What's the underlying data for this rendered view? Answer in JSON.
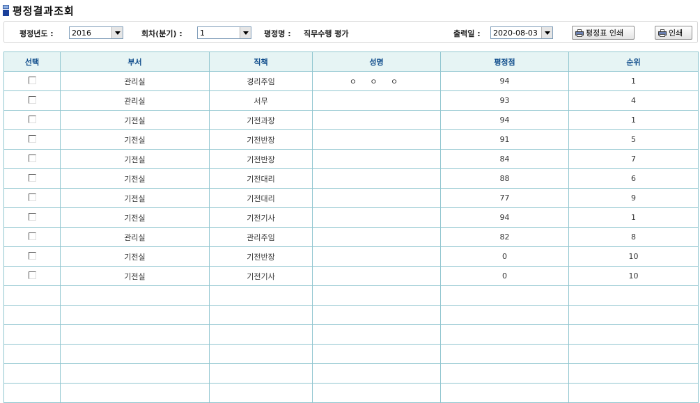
{
  "page": {
    "title": "평정결과조회"
  },
  "filters": {
    "year_label": "평정년도 :",
    "year_value": "2016",
    "round_label": "회차(분기) :",
    "round_value": "1",
    "eval_name_label": "평정명 :",
    "eval_name_value": "직무수행 평가",
    "print_date_label": "출력일 :",
    "print_date_value": "2020-08-03",
    "print_sheet_button": "평정표 인쇄",
    "print_button": "인쇄"
  },
  "table": {
    "headers": [
      "선택",
      "부서",
      "직책",
      "성명",
      "평정점",
      "순위"
    ],
    "rows": [
      [
        "관리실",
        "경리주임",
        "ㅇ ㅇ ㅇ",
        "94",
        "1"
      ],
      [
        "관리실",
        "서무",
        "",
        "93",
        "4"
      ],
      [
        "기전실",
        "기전과장",
        "",
        "94",
        "1"
      ],
      [
        "기전실",
        "기전반장",
        "",
        "91",
        "5"
      ],
      [
        "기전실",
        "기전반장",
        "",
        "84",
        "7"
      ],
      [
        "기전실",
        "기전대리",
        "",
        "88",
        "6"
      ],
      [
        "기전실",
        "기전대리",
        "",
        "77",
        "9"
      ],
      [
        "기전실",
        "기전기사",
        "",
        "94",
        "1"
      ],
      [
        "관리실",
        "관리주임",
        "",
        "82",
        "8"
      ],
      [
        "기전실",
        "기전반장",
        "",
        "0",
        "10"
      ],
      [
        "기전실",
        "기전기사",
        "",
        "0",
        "10"
      ]
    ],
    "empty_rows": 6
  },
  "colors": {
    "header_bg": "#e6f4f4",
    "header_text": "#0c4a8a",
    "grid_border": "#8fc5cf"
  },
  "icons": {
    "title": "page-title-icon",
    "print": "printer-icon"
  }
}
